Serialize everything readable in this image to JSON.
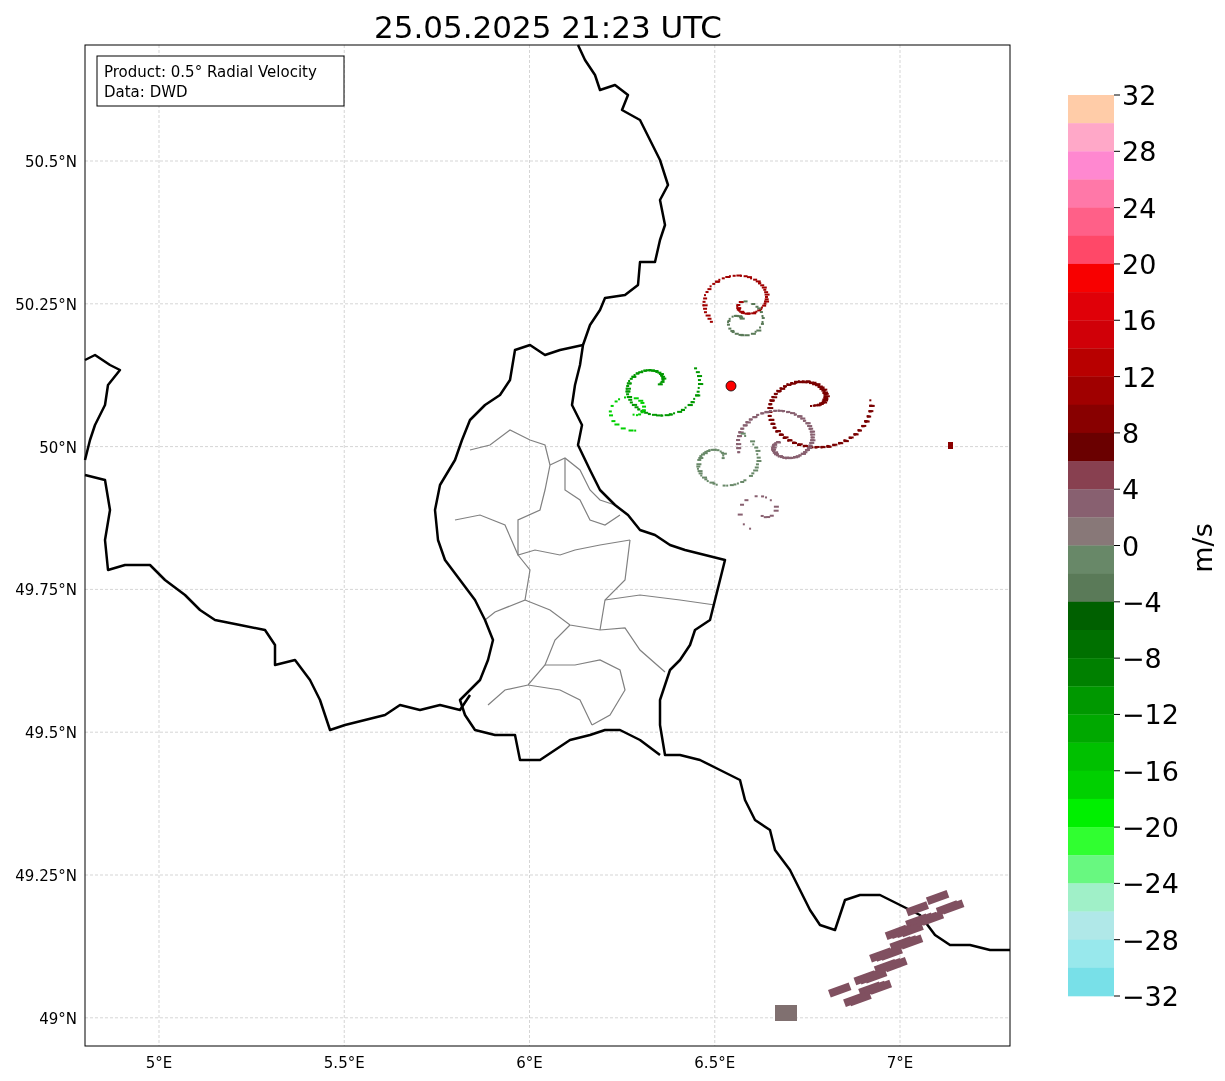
{
  "title": "25.05.2025 21:23 UTC",
  "legend": [
    "Product: 0.5° Radial Velocity",
    "Data: DWD"
  ],
  "y_ticks": [
    "50.5°N",
    "50.25°N",
    "50°N",
    "49.75°N",
    "49.5°N",
    "49.25°N",
    "49°N"
  ],
  "x_ticks": [
    "5°E",
    "5.5°E",
    "6°E",
    "6.5°E",
    "7°E"
  ],
  "colorbar": {
    "label": "m/s",
    "ticks": [
      "32",
      "28",
      "24",
      "20",
      "16",
      "12",
      "8",
      "4",
      "0",
      "−4",
      "−8",
      "−12",
      "−16",
      "−20",
      "−24",
      "−28",
      "−32"
    ],
    "bins": [
      {
        "color": "#ffcca8"
      },
      {
        "color": "#ffa8c8"
      },
      {
        "color": "#ff88d0"
      },
      {
        "color": "#ff78a8"
      },
      {
        "color": "#ff6088"
      },
      {
        "color": "#ff4868"
      },
      {
        "color": "#f80000"
      },
      {
        "color": "#e00008"
      },
      {
        "color": "#d00008"
      },
      {
        "color": "#b80000"
      },
      {
        "color": "#a00000"
      },
      {
        "color": "#880000"
      },
      {
        "color": "#6a0000"
      },
      {
        "color": "#884050"
      },
      {
        "color": "#886070"
      },
      {
        "color": "#887878"
      },
      {
        "color": "#688868"
      },
      {
        "color": "#5a7a58"
      },
      {
        "color": "#006000"
      },
      {
        "color": "#007000"
      },
      {
        "color": "#008000"
      },
      {
        "color": "#009800"
      },
      {
        "color": "#00a800"
      },
      {
        "color": "#00c000"
      },
      {
        "color": "#00d000"
      },
      {
        "color": "#00f000"
      },
      {
        "color": "#30ff30"
      },
      {
        "color": "#68f880"
      },
      {
        "color": "#a0f0c8"
      },
      {
        "color": "#b0e8e8"
      },
      {
        "color": "#98e8ec"
      },
      {
        "color": "#78e0e8"
      }
    ]
  }
}
